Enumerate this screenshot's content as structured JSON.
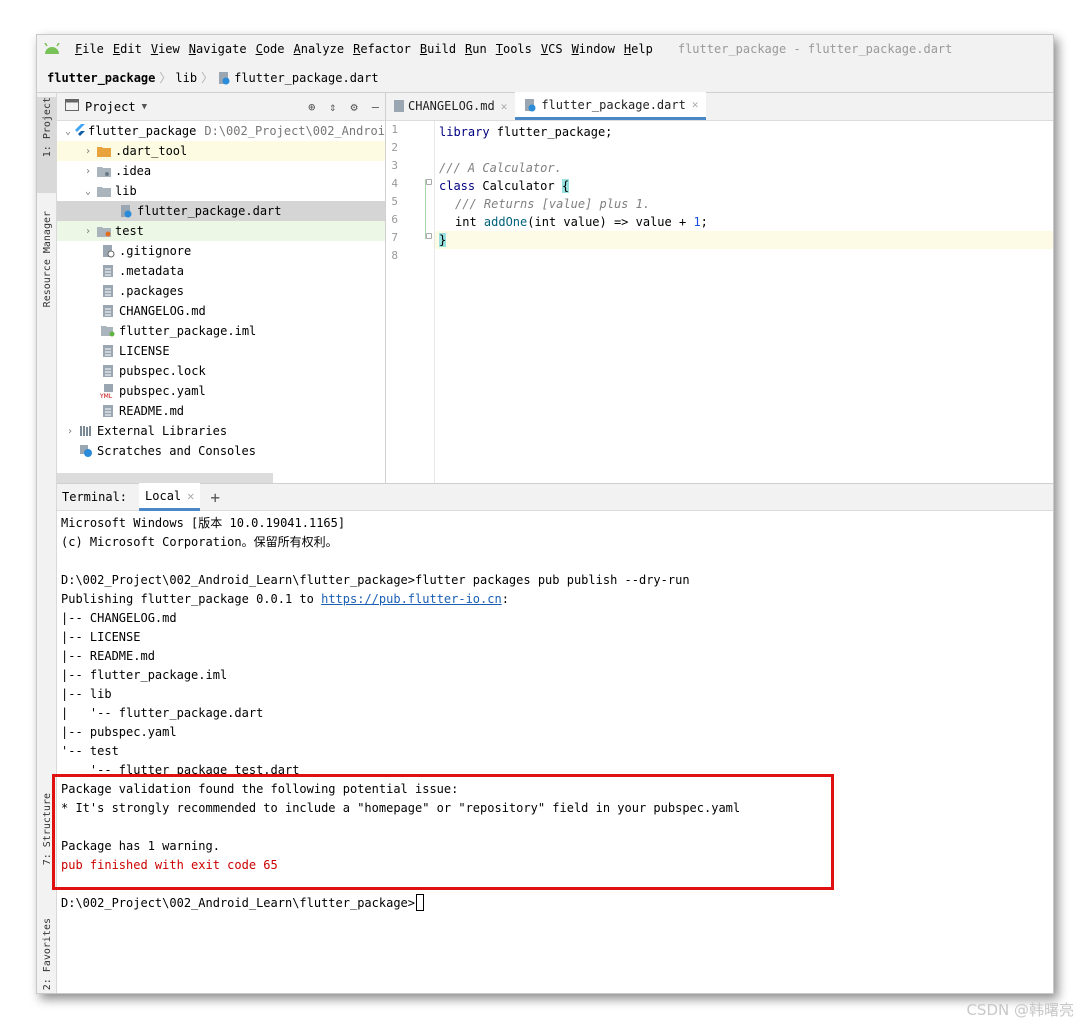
{
  "menubar": {
    "items": [
      "File",
      "Edit",
      "View",
      "Navigate",
      "Code",
      "Analyze",
      "Refactor",
      "Build",
      "Run",
      "Tools",
      "VCS",
      "Window",
      "Help"
    ],
    "window_title": "flutter_package - flutter_package.dart"
  },
  "navbar": {
    "crumbs": [
      "flutter_package",
      "lib",
      "flutter_package.dart"
    ]
  },
  "sidebar": {
    "project_tab": "1: Project",
    "resource_tab": "Resource Manager",
    "structure_tab": "7: Structure",
    "favorites_tab": "2: Favorites"
  },
  "project_panel": {
    "title": "Project",
    "root": {
      "name": "flutter_package",
      "path": "D:\\002_Project\\002_Androi"
    },
    "items": [
      {
        "label": ".dart_tool"
      },
      {
        "label": ".idea"
      },
      {
        "label": "lib"
      },
      {
        "label": "flutter_package.dart"
      },
      {
        "label": "test"
      },
      {
        "label": ".gitignore"
      },
      {
        "label": ".metadata"
      },
      {
        "label": ".packages"
      },
      {
        "label": "CHANGELOG.md"
      },
      {
        "label": "flutter_package.iml"
      },
      {
        "label": "LICENSE"
      },
      {
        "label": "pubspec.lock"
      },
      {
        "label": "pubspec.yaml"
      },
      {
        "label": "README.md"
      },
      {
        "label": "External Libraries"
      },
      {
        "label": "Scratches and Consoles"
      }
    ]
  },
  "editor": {
    "tabs": [
      {
        "label": "CHANGELOG.md"
      },
      {
        "label": "flutter_package.dart"
      }
    ],
    "line_numbers": [
      "1",
      "2",
      "3",
      "4",
      "5",
      "6",
      "7",
      "8"
    ],
    "code": {
      "l1_kw": "library",
      "l1_rest": " flutter_package;",
      "l3": "/// A Calculator.",
      "l4_kw": "class",
      "l4_rest": " Calculator ",
      "l4_brace": "{",
      "l5": "/// Returns [value] plus 1.",
      "l6_a": "int ",
      "l6_fn": "addOne",
      "l6_b": "(int value) => value + ",
      "l6_num": "1",
      "l6_c": ";",
      "l7_brace": "}"
    }
  },
  "terminal": {
    "label": "Terminal:",
    "tab": "Local",
    "lines": [
      "Microsoft Windows [版本 10.0.19041.1165]",
      "(c) Microsoft Corporation。保留所有权利。",
      "",
      "D:\\002_Project\\002_Android_Learn\\flutter_package>flutter packages pub publish --dry-run",
      "Publishing flutter_package 0.0.1 to ",
      "|-- CHANGELOG.md",
      "|-- LICENSE",
      "|-- README.md",
      "|-- flutter_package.iml",
      "|-- lib",
      "|   '-- flutter_package.dart",
      "|-- pubspec.yaml",
      "'-- test",
      "    '-- flutter_package_test.dart",
      "Package validation found the following potential issue:",
      "* It's strongly recommended to include a \"homepage\" or \"repository\" field in your pubspec.yaml",
      "",
      "Package has 1 warning.",
      "pub finished with exit code 65",
      "",
      "D:\\002_Project\\002_Android_Learn\\flutter_package>"
    ],
    "link": "https://pub.flutter-io.cn",
    "link_suffix": ":"
  },
  "watermark": "CSDN @韩曙亮",
  "colors": {
    "accent": "#4a88c7",
    "error_red": "#cc0000",
    "highlight_box": "#e01010",
    "folder_orange": "#e8a33d",
    "flutter_blue": "#42a5f5"
  }
}
